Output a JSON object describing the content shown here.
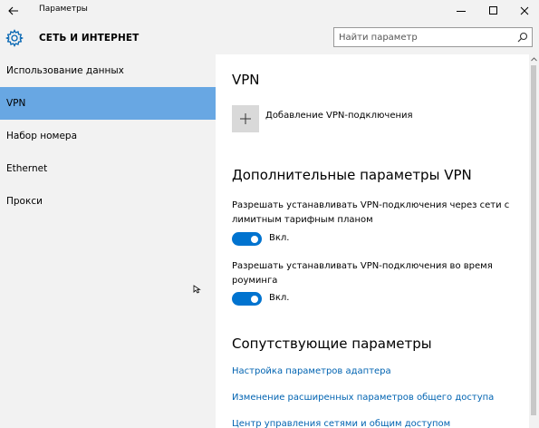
{
  "window": {
    "title": "Параметры"
  },
  "header": {
    "section_title": "СЕТЬ И ИНТЕРНЕТ",
    "search_placeholder": "Найти параметр"
  },
  "sidebar": {
    "items": [
      {
        "label": "Использование данных"
      },
      {
        "label": "VPN",
        "active": true
      },
      {
        "label": "Набор номера"
      },
      {
        "label": "Ethernet"
      },
      {
        "label": "Прокси"
      }
    ]
  },
  "main": {
    "vpn_title": "VPN",
    "add_vpn_label": "Добавление VPN-подключения",
    "advanced_title": "Дополнительные параметры VPN",
    "metered_desc": "Разрешать устанавливать VPN-подключения через сети с лимитным тарифным планом",
    "metered_toggle": {
      "state": "on",
      "label": "Вкл."
    },
    "roaming_desc": "Разрешать устанавливать VPN-подключения во время роуминга",
    "roaming_toggle": {
      "state": "on",
      "label": "Вкл."
    },
    "related_title": "Сопутствующие параметры",
    "links": [
      "Настройка параметров адаптера",
      "Изменение расширенных параметров общего доступа",
      "Центр управления сетями и общим доступом"
    ]
  },
  "colors": {
    "accent": "#0073cf",
    "selection": "#68a7e3",
    "link": "#0063b1",
    "chrome": "#f2f2f2"
  },
  "icons": [
    "back-arrow-icon",
    "minimize-icon",
    "maximize-icon",
    "close-icon",
    "gear-icon",
    "search-icon",
    "plus-icon",
    "cursor-icon",
    "scroll-up-icon"
  ]
}
